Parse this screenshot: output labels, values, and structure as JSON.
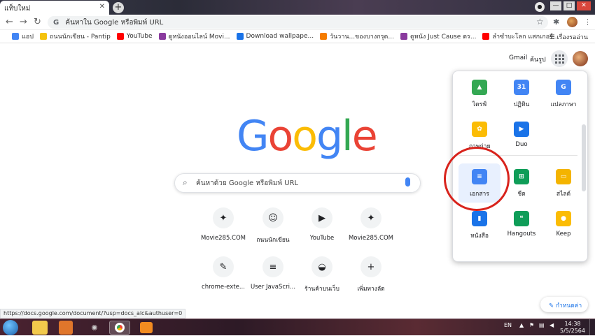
{
  "tab": {
    "title": "แท็บใหม่",
    "close": "✕",
    "new": "+"
  },
  "window": {
    "min": "—",
    "max": "□",
    "close": "✕"
  },
  "toolbar": {
    "back": "←",
    "forward": "→",
    "reload": "↻",
    "omnibox_text": "ค้นหาใน Google หรือพิมพ์ URL",
    "omnibox_icon": "G",
    "star": "☆",
    "menu": "⋮"
  },
  "bookmarks": [
    {
      "label": "แอป",
      "color": "#4285f4"
    },
    {
      "label": "ถนนนักเขียน - Pantip",
      "color": "#f4c20d"
    },
    {
      "label": "YouTube",
      "color": "#ff0000"
    },
    {
      "label": "ดูหนังออนไลน์ Movi...",
      "color": "#8a3b9e"
    },
    {
      "label": "Download wallpape...",
      "color": "#1a73e8"
    },
    {
      "label": "วันวาน...ของบางกรุด...",
      "color": "#f57c00"
    },
    {
      "label": "ดูหนัง Just Cause ตร...",
      "color": "#8a3b9e"
    },
    {
      "label": "ลำซำบะโลก แสกเกอร์...",
      "color": "#ff0000"
    }
  ],
  "bookmarks_right": "เรื่องรออ่าน",
  "header": {
    "gmail": "Gmail",
    "images": "ค้นรูป"
  },
  "logo": [
    {
      "ch": "G",
      "color": "#4285f4"
    },
    {
      "ch": "o",
      "color": "#ea4335"
    },
    {
      "ch": "o",
      "color": "#fbbc05"
    },
    {
      "ch": "g",
      "color": "#4285f4"
    },
    {
      "ch": "l",
      "color": "#34a853"
    },
    {
      "ch": "e",
      "color": "#ea4335"
    }
  ],
  "search": {
    "placeholder": "ค้นหาด้วย Google หรือพิมพ์ URL",
    "icon": "⌕"
  },
  "shortcuts": [
    {
      "label": "Movie285.COM",
      "glyph": "✦"
    },
    {
      "label": "ถนนนักเขียน",
      "glyph": "☺"
    },
    {
      "label": "YouTube",
      "glyph": "▶"
    },
    {
      "label": "Movie285.COM",
      "glyph": "✦"
    },
    {
      "label": "chrome-exte...",
      "glyph": "✎"
    },
    {
      "label": "User JavaScri...",
      "glyph": "≡"
    },
    {
      "label": "ร้านค้าบนเว็บ",
      "glyph": "◒"
    },
    {
      "label": "เพิ่มทางลัด",
      "glyph": "+"
    }
  ],
  "apps": [
    {
      "label": "ไดรฟ์",
      "glyph": "▲",
      "color": "#34a853"
    },
    {
      "label": "ปฏิทิน",
      "glyph": "31",
      "color": "#4285f4"
    },
    {
      "label": "แปลภาษา",
      "glyph": "G",
      "color": "#4285f4"
    },
    {
      "label": "ภาพถ่าย",
      "glyph": "✿",
      "color": "#fbbc05"
    },
    {
      "label": "Duo",
      "glyph": "▶",
      "color": "#1a73e8"
    },
    {
      "label": "เอกสาร",
      "glyph": "≡",
      "color": "#4285f4"
    },
    {
      "label": "ชีต",
      "glyph": "⊞",
      "color": "#0f9d58"
    },
    {
      "label": "สไลด์",
      "glyph": "▭",
      "color": "#f4b400"
    },
    {
      "label": "หนังสือ",
      "glyph": "▮",
      "color": "#1a73e8"
    },
    {
      "label": "Hangouts",
      "glyph": "❝",
      "color": "#0f9d58"
    },
    {
      "label": "Keep",
      "glyph": "●",
      "color": "#fbbc05"
    }
  ],
  "customize": {
    "label": "กำหนดค่า",
    "icon": "✎"
  },
  "status_url": "https://docs.google.com/document/?usp=docs_alc&authuser=0",
  "taskbar": {
    "lang": "EN",
    "time": "14:38",
    "date": "5/5/2564"
  }
}
